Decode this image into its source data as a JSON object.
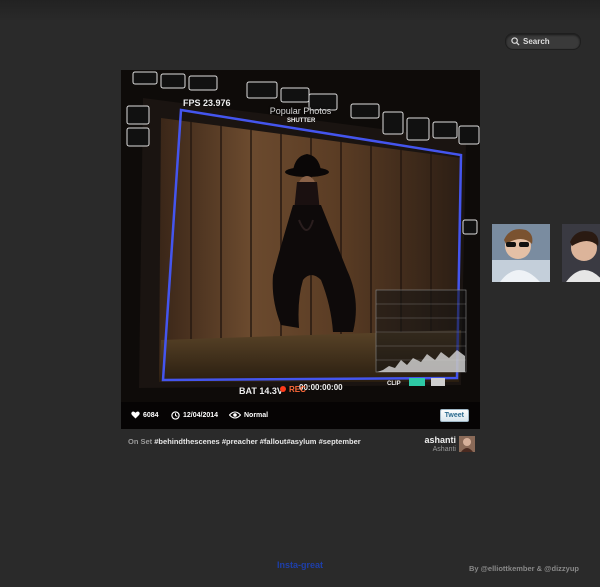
{
  "search": {
    "placeholder": "Search"
  },
  "section": {
    "title": "Popular Photos"
  },
  "photo": {
    "monitor": {
      "fps": "FPS 23.976",
      "shutter": "SHUTTER",
      "battery": "BAT 14.3V",
      "rec": "REC",
      "timecode": "00:00:00:00",
      "clip": "CLIP"
    },
    "likes": "6084",
    "date": "12/04/2014",
    "filter": "Normal",
    "tweet_label": "Tweet"
  },
  "caption": {
    "prefix": "On Set",
    "tags": [
      "#behindthescenes",
      "#preacher",
      "#fallout",
      "#asylum",
      "#september"
    ]
  },
  "user": {
    "username": "ashanti",
    "full_name": "Ashanti"
  },
  "footer": {
    "link": "Insta-great",
    "credits": "By @elliottkember & @dizzyup"
  },
  "colors": {
    "background": "#2a2a2a",
    "link": "#1e3faa",
    "monitor_frame": "#4455ee",
    "rec": "#ff3a1a"
  }
}
